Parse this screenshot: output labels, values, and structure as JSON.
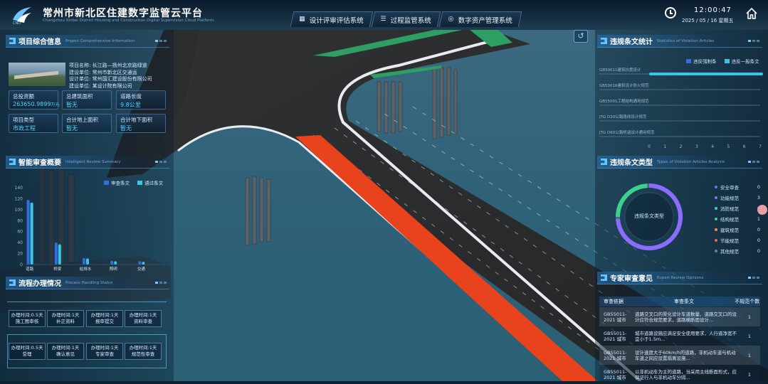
{
  "header": {
    "logo_text": "CND",
    "title": "常州市新北区住建数字监管云平台",
    "subtitle": "Changzhou Xinbei District Housing and Construction Digital Supervision Cloud Platform",
    "tabs": [
      {
        "label": "设计评审评估系统",
        "icon": "chart-icon"
      },
      {
        "label": "过程监管系统",
        "icon": "list-icon"
      },
      {
        "label": "数字资产管理系统",
        "icon": "asset-icon"
      }
    ],
    "time": "12:00:47",
    "date": "2025 / 05 / 16 星期五"
  },
  "project": {
    "title": "项目综合信息",
    "title_en": "Project Comprehensive Information",
    "lines": [
      "项目名称: 长江路—扬州北京路绿道",
      "建设单位: 常州市新北区交通运",
      "设计单位: 常州国汇建设股份有限公司",
      "建设单位: 某设计院有限公司"
    ],
    "stats": [
      {
        "label": "总投资额",
        "value": "263650.9899",
        "unit": "万元"
      },
      {
        "label": "总建筑面积",
        "value": "暂无",
        "unit": ""
      },
      {
        "label": "道路长度",
        "value": "9.8公里",
        "unit": ""
      },
      {
        "label": "项目类型",
        "value": "市政工程",
        "unit": ""
      },
      {
        "label": "合计地上面积",
        "value": "暂无",
        "unit": ""
      },
      {
        "label": "合计地下面积",
        "value": "暂无",
        "unit": ""
      }
    ]
  },
  "review": {
    "title": "智能审查概要",
    "title_en": "Intelligent Review Summary",
    "legend": [
      "审查条文",
      "通过条文"
    ],
    "chart_data": {
      "type": "bar",
      "categories": [
        "道路",
        "桥梁",
        "给排水",
        "照明",
        "交通"
      ],
      "series": [
        {
          "name": "审查条文",
          "values": [
            118,
            40,
            12,
            7,
            6
          ]
        },
        {
          "name": "通过条文",
          "values": [
            113,
            37,
            11,
            6,
            5
          ]
        }
      ],
      "ylim": [
        0,
        140
      ],
      "yticks": [
        0,
        20,
        40,
        60,
        80,
        100,
        120,
        140
      ]
    }
  },
  "process": {
    "title": "流程办理情况",
    "title_en": "Process Handling Status",
    "row1": [
      {
        "l1": "办理时间:0.5天",
        "l2": "施工图审核"
      },
      {
        "l1": "办理时间:1天",
        "l2": "补正资料"
      },
      {
        "l1": "办理时间:1天",
        "l2": "报审提交"
      },
      {
        "l1": "办理时间:1天",
        "l2": "资料审查"
      }
    ],
    "row2": [
      {
        "l1": "办理时间:0.5天",
        "l2": "受理"
      },
      {
        "l1": "办理时间:1天",
        "l2": "确认意见"
      },
      {
        "l1": "办理时间:1天",
        "l2": "专家审查"
      },
      {
        "l1": "办理时间:1天",
        "l2": "规范性审查"
      }
    ]
  },
  "violations": {
    "title": "违规条文统计",
    "title_en": "Statistics of Violation Articles",
    "legend": [
      "违反强制条",
      "违反一般条文"
    ],
    "chart_data": {
      "type": "bar",
      "categories": [
        "GB50011建筑抗震设计",
        "GB50016建筑设计防火规范",
        "GB55001工程结构通用规范",
        "JTG D20公路路线设计规范",
        "JTG D60公路桥涵设计通用规范"
      ],
      "series": [
        {
          "name": "违反强制条",
          "values": [
            0,
            0,
            0,
            0,
            0
          ]
        },
        {
          "name": "违反一般条文",
          "values": [
            7,
            0,
            0,
            0,
            0
          ]
        }
      ],
      "xticks": [
        0,
        1,
        2,
        3,
        4,
        5,
        6,
        7
      ],
      "xlim": [
        0,
        7
      ]
    }
  },
  "types": {
    "title": "违规条文类型",
    "title_en": "Types of Violation Articles Analysis",
    "center": "违规条文类型",
    "items": [
      {
        "name": "安全审查",
        "count": 0,
        "color": "#4d7cff"
      },
      {
        "name": "功能规范",
        "count": 3,
        "color": "#8c6bff"
      },
      {
        "name": "消防规范",
        "count": 0,
        "color": "#3fc9e8"
      },
      {
        "name": "结构规范",
        "count": 1,
        "color": "#3ad28c"
      },
      {
        "name": "建筑规范",
        "count": 0,
        "color": "#ff8a3a"
      },
      {
        "name": "节能规范",
        "count": 0,
        "color": "#ff5a5a"
      },
      {
        "name": "其他规范",
        "count": 0,
        "color": "#6b7f95"
      }
    ]
  },
  "expert": {
    "title": "专家审查意见",
    "title_en": "Expert Review Opinions",
    "headers": [
      "审查依据",
      "审查条文",
      "不规范个数"
    ],
    "rows": [
      {
        "basis": "GB55011-2021 城市",
        "text": "道路交叉口的渠化设计车道数量、道路交叉口的设计应符合规范要求，道路横断面设计...",
        "count": "1"
      },
      {
        "basis": "GB55011-2021 城市",
        "text": "城市道路设施应满足安全使用要求，人行道净宽不宜小于1.5m...",
        "count": "1"
      },
      {
        "basis": "GB55011-2021 城市",
        "text": "设计速度大于60km/h的道路，非机动车道与机动车道之间应设置隔离设施...",
        "count": "1"
      },
      {
        "basis": "GB55011-2021 城市",
        "text": "以非机动车为主的道路，当采用主线断面形式，应保证行人与非机动车分隔...",
        "count": "1"
      }
    ]
  }
}
